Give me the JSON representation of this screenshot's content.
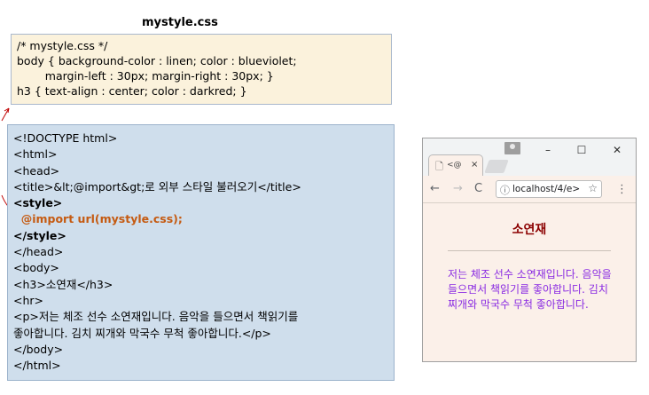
{
  "css_panel": {
    "title": "mystyle.css",
    "lines": [
      "/* mystyle.css */",
      "body { background-color : linen; color : blueviolet;",
      "        margin-left : 30px; margin-right : 30px; }",
      "h3 { text-align : center; color : darkred; }"
    ]
  },
  "html_panel": {
    "lines": [
      "<!DOCTYPE html>",
      "<html>",
      "<head>",
      "<title>&lt;@import&gt;로 외부 스타일 불러오기</title>",
      "<style>",
      "  @import url(mystyle.css);",
      "</style>",
      "</head>",
      "<body>",
      "<h3>소연재</h3>",
      "<hr>",
      "<p>저는 체조 선수 소연재입니다. 음악을 들으면서 책읽기를",
      "좋아합니다. 김치 찌개와 막국수 무척 좋아합니다.</p>",
      "</body>",
      "</html>"
    ]
  },
  "browser": {
    "tab_title": "<@",
    "tab_close": "×",
    "minimize": "–",
    "maximize": "☐",
    "close": "✕",
    "back": "←",
    "forward": "→",
    "reload": "C",
    "url": "localhost/4/e>",
    "star": "☆",
    "menu": "⋮",
    "heading": "소연재",
    "paragraph": "저는 체조 선수 소연재입니다. 음악을 들으면서 책읽기를 좋아합니다. 김치 찌개와 막국수 무척 좋아합니다.",
    "colors": {
      "background": "#faf0e6",
      "text": "#8a2be2",
      "heading": "#8b0000"
    }
  }
}
